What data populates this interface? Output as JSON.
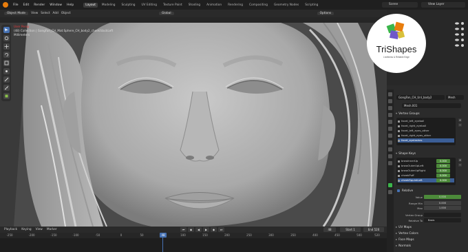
{
  "topbar": {
    "menus": [
      "File",
      "Edit",
      "Render",
      "Window",
      "Help"
    ],
    "workspaces": [
      "Layout",
      "Modeling",
      "Sculpting",
      "UV Editing",
      "Texture Paint",
      "Shading",
      "Animation",
      "Rendering",
      "Compositing",
      "Geometry Nodes",
      "Scripting"
    ],
    "active_workspace": "Layout",
    "scene": "Scene",
    "view_layer": "View Layer"
  },
  "viewport_header": {
    "mode": "Object Mode",
    "view": "View",
    "select": "Select",
    "add": "Add",
    "object": "Object",
    "transform_orientation": "Global",
    "options": "Options"
  },
  "viewport_info": {
    "perspective": "User Persp",
    "collection": "(48) Collection | GongFan_CH_Mat:Sphere_CH_body2_cheekSlackLeft",
    "units": "Millimeters"
  },
  "logo": {
    "name": "TriShapes",
    "tagline": "Liveliness & Reliable Edge",
    "colors": [
      "#e87d0d",
      "#3bb54a",
      "#6f58c9",
      "#d9c13b"
    ]
  },
  "properties": {
    "object_name": "GongFan_CH_UnI_body2",
    "mesh_short": "Mesh",
    "mesh_data": "Mesh.001",
    "vertex_groups": {
      "title": "Vertex Groups",
      "items": [
        "facet_left_eyeball",
        "facet_right_eyeball",
        "facet_left_eyes_other",
        "facet_right_eyes_other",
        "facet_eyelashes"
      ],
      "selected_index": 4
    },
    "shape_keys": {
      "title": "Shape Keys",
      "items": [
        {
          "name": "browInnerUp",
          "value": "0.000"
        },
        {
          "name": "browOuterUpLeft",
          "value": "0.000"
        },
        {
          "name": "browOuterUpRight",
          "value": "0.000"
        },
        {
          "name": "cheekPuff",
          "value": "0.000"
        },
        {
          "name": "cheekSquintLeft",
          "value": "0.000"
        }
      ],
      "selected_index": 4
    },
    "relative": {
      "label": "Relative",
      "value_label": "Value",
      "value": "0.000",
      "range_min_label": "Range Min",
      "range_min": "0.000",
      "max_label": "Max",
      "max": "1.000",
      "vertex_group_label": "Vertex Group",
      "relative_to_label": "Relative To",
      "relative_to": "Basis"
    },
    "collapsed_sections": [
      "UV Maps",
      "Vertex Colors",
      "Face Maps",
      "Normals"
    ]
  },
  "timeline": {
    "playback": "Playback",
    "keying": "Keying",
    "view": "View",
    "marker": "Marker",
    "current_frame": "48",
    "start_label": "Start",
    "start": "1",
    "end_label": "End",
    "end": "520",
    "ticks": [
      "-250",
      "-200",
      "-150",
      "-100",
      "-50",
      "0",
      "50",
      "100",
      "150",
      "200",
      "250",
      "300",
      "350",
      "400",
      "450",
      "500",
      "520"
    ]
  },
  "outliner": {
    "rows": [
      "Scene Collection",
      "Collection",
      "Camera",
      "Light",
      "GongFan_CH_Mat"
    ]
  }
}
